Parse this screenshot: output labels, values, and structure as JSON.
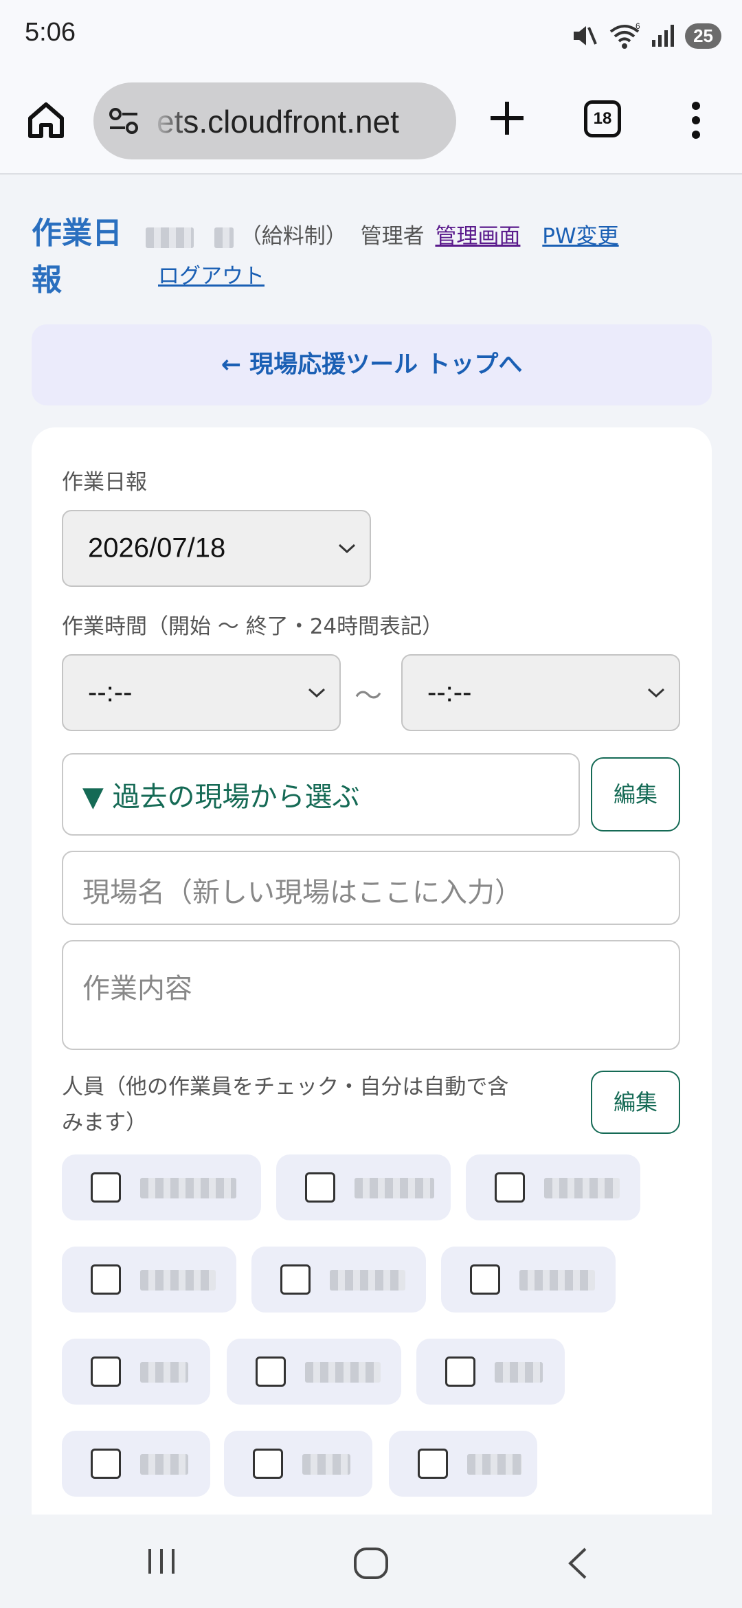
{
  "status": {
    "time": "5:06",
    "battery": "25",
    "wifi_badge": "6"
  },
  "browser": {
    "url": "ets.cloudfront.net",
    "tab_count": "18"
  },
  "header": {
    "app_title": "作業日報",
    "user_type": "（給料制）",
    "role": "管理者",
    "admin_link": "管理画面",
    "pw_link": "PW変更",
    "logout_link": "ログアウト"
  },
  "back_banner": "← 現場応援ツール トップへ",
  "form": {
    "report_label": "作業日報",
    "date_value": "2026/07/18",
    "time_label": "作業時間（開始 〜 終了・24時間表記）",
    "start_time": "--:--",
    "end_time": "--:--",
    "tilde": "〜",
    "past_site_picker": "▼ 過去の現場から選ぶ",
    "edit_label": "編集",
    "site_placeholder": "現場名（新しい現場はここに入力）",
    "content_placeholder": "作業内容",
    "members_label_line1": "人員（他の作業員をチェック・自分は自動で含",
    "members_label_line2": "みます）",
    "members_edit_label": "編集"
  },
  "nav": {
    "recent": "recent-apps-icon",
    "home": "home-icon",
    "back": "back-icon"
  }
}
